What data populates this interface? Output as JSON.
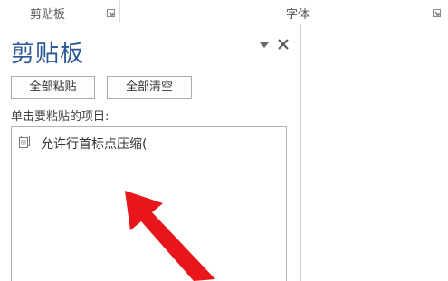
{
  "ribbon": {
    "groups": [
      {
        "label": "剪贴板"
      },
      {
        "label": "字体"
      }
    ]
  },
  "pane": {
    "title": "剪贴板",
    "paste_all_label": "全部粘贴",
    "clear_all_label": "全部清空",
    "instruction": "单击要粘贴的项目:",
    "items": [
      {
        "text": "允许行首标点压缩(",
        "icon": "document-icon"
      }
    ]
  },
  "colors": {
    "title_blue": "#2b5797",
    "arrow_red": "#e8161b"
  }
}
